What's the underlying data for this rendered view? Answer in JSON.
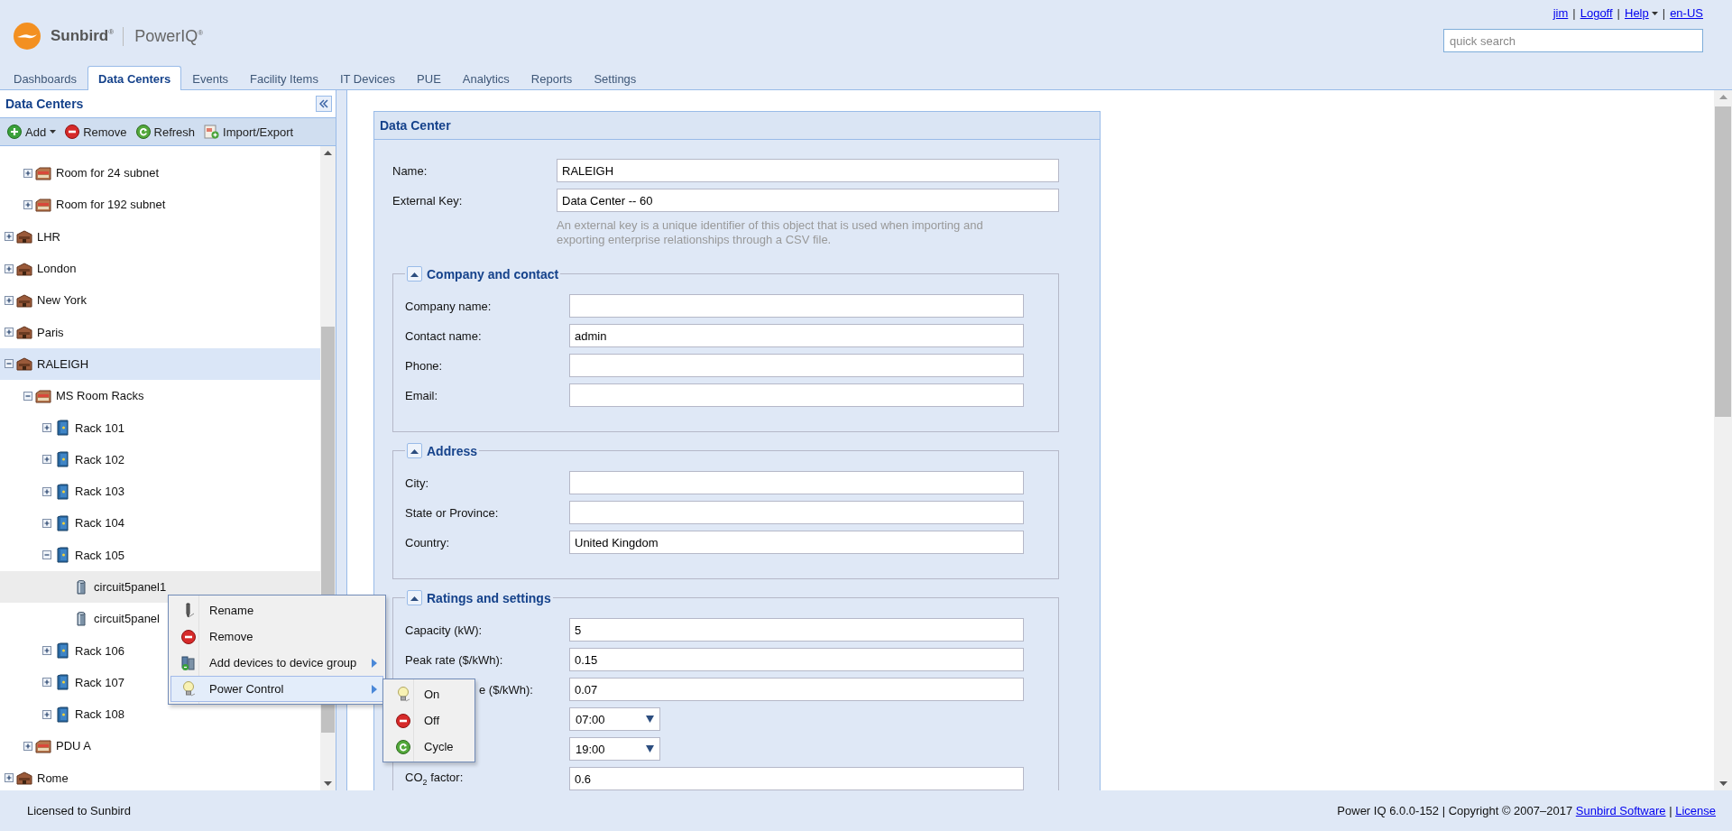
{
  "header": {
    "logo": {
      "brand": "Sunbird$^{®}$",
      "product": "PowerIQ$^{®}$"
    },
    "user_links": [
      {
        "label": "jim",
        "dropdown": false
      },
      {
        "label": "Logoff",
        "dropdown": false
      },
      {
        "label": "Help",
        "dropdown": true
      },
      {
        "label": "en-US",
        "dropdown": false
      }
    ],
    "separator": "|",
    "search": {
      "placeholder": "quick search"
    }
  },
  "tabs": [
    {
      "label": "Dashboards",
      "selected": false
    },
    {
      "label": "Data Centers",
      "selected": true
    },
    {
      "label": "Events",
      "selected": false
    },
    {
      "label": "Facility Items",
      "selected": false
    },
    {
      "label": "IT Devices",
      "selected": false
    },
    {
      "label": "PUE",
      "selected": false
    },
    {
      "label": "Analytics",
      "selected": false
    },
    {
      "label": "Reports",
      "selected": false
    },
    {
      "label": "Settings",
      "selected": false
    }
  ],
  "sidebar": {
    "title": "Data Centers",
    "toolbar": [
      {
        "label": "Add",
        "kind": "add",
        "dropdown": true
      },
      {
        "label": "Remove",
        "kind": "remove",
        "dropdown": false
      },
      {
        "label": "Refresh",
        "kind": "refresh",
        "dropdown": false
      },
      {
        "label": "Import/Export",
        "kind": "import",
        "dropdown": false
      }
    ]
  },
  "tree": {
    "items": [
      {
        "children": [
          {
            "label": "Room for 24 subnet",
            "kind": "room",
            "expanded": false,
            "selected": false,
            "hovered": false
          },
          {
            "label": "Room for 192 subnet",
            "kind": "room",
            "expanded": false,
            "selected": false,
            "hovered": false
          }
        ]
      },
      {
        "label": "LHR",
        "kind": "building",
        "expanded": false,
        "selected": false,
        "hovered": false
      },
      {
        "label": "London",
        "kind": "building",
        "expanded": false,
        "selected": false,
        "hovered": false
      },
      {
        "label": "New York",
        "kind": "building",
        "expanded": false,
        "selected": false,
        "hovered": false
      },
      {
        "label": "Paris",
        "kind": "building",
        "expanded": false,
        "selected": false,
        "hovered": false
      },
      {
        "label": "RALEIGH",
        "kind": "building",
        "expanded": true,
        "selected": true,
        "hovered": false,
        "children": [
          {
            "label": "MS Room Racks",
            "kind": "room",
            "expanded": true,
            "selected": false,
            "hovered": false,
            "children": [
              {
                "label": "Rack 101",
                "kind": "rack",
                "expanded": false,
                "selected": false,
                "hovered": false
              },
              {
                "label": "Rack 102",
                "kind": "rack",
                "expanded": false,
                "selected": false,
                "hovered": false
              },
              {
                "label": "Rack 103",
                "kind": "rack",
                "expanded": false,
                "selected": false,
                "hovered": false
              },
              {
                "label": "Rack 104",
                "kind": "rack",
                "expanded": false,
                "selected": false,
                "hovered": false
              },
              {
                "label": "Rack 105",
                "kind": "rack",
                "expanded": true,
                "selected": false,
                "hovered": false,
                "children": [
                  {
                    "label": "circuit5panel1",
                    "kind": "device",
                    "selected": false,
                    "hovered": true
                  },
                  {
                    "label": "circuit5panel",
                    "kind": "device",
                    "selected": false,
                    "hovered": false
                  }
                ]
              },
              {
                "label": "Rack 106",
                "kind": "rack",
                "expanded": false,
                "selected": false,
                "hovered": false
              },
              {
                "label": "Rack 107",
                "kind": "rack",
                "expanded": false,
                "selected": false,
                "hovered": false
              },
              {
                "label": "Rack 108",
                "kind": "rack",
                "expanded": false,
                "selected": false,
                "hovered": false
              }
            ]
          },
          {
            "label": "PDU A",
            "kind": "room",
            "expanded": false,
            "selected": false,
            "hovered": false
          }
        ]
      },
      {
        "label": "Rome",
        "kind": "building",
        "expanded": false,
        "selected": false,
        "hovered": false
      }
    ]
  },
  "context_menu": {
    "items": [
      {
        "label": "Rename",
        "kind": "rename",
        "submenu": false,
        "selected": false
      },
      {
        "label": "Remove",
        "kind": "remove",
        "submenu": false,
        "selected": false
      },
      {
        "label": "Add devices to device group",
        "kind": "group",
        "submenu": true,
        "selected": false
      },
      {
        "label": "Power Control",
        "kind": "power",
        "submenu": true,
        "selected": true
      }
    ],
    "submenu": {
      "items": [
        {
          "label": "On",
          "kind": "on",
          "selected": false
        },
        {
          "label": "Off",
          "kind": "off",
          "selected": false
        },
        {
          "label": "Cycle",
          "kind": "cycle",
          "selected": false
        }
      ]
    }
  },
  "form": {
    "title": "Data Center",
    "fields": [
      {
        "label": "Name:",
        "value": "RALEIGH"
      },
      {
        "label": "External Key:",
        "value": "Data Center -- 60"
      }
    ],
    "hint": "An external key is a unique identifier of this object that is used when importing and exporting enterprise relationships through a CSV file.",
    "sections": [
      {
        "title": "Company and contact",
        "expanded": true,
        "fields": [
          {
            "label": "Company name:"
          },
          {
            "label": "Contact name:",
            "value": "admin"
          },
          {
            "label": "Phone:"
          },
          {
            "label": "Email:"
          }
        ]
      },
      {
        "title": "Address",
        "expanded": true,
        "fields": [
          {
            "label": "City:"
          },
          {
            "label": "State or Province:"
          },
          {
            "label": "Country:",
            "value": "United Kingdom"
          }
        ]
      },
      {
        "title": "Ratings and settings",
        "expanded": true,
        "fields": [
          {
            "kind": "text",
            "label": "Capacity (kW):",
            "value": "5"
          },
          {
            "kind": "text",
            "label": "Peak rate ($/kWh):",
            "value": "0.15"
          },
          {
            "kind": "text",
            "label": "e ($/kWh):",
            "obscured": true,
            "value": "0.07"
          },
          {
            "kind": "select",
            "value": "07:00"
          },
          {
            "kind": "select",
            "value": "19:00"
          },
          {
            "kind": "text",
            "label": "CO$_{2}$ factor:",
            "value": "0.6"
          }
        ]
      }
    ]
  },
  "footer": {
    "license": "Licensed to Sunbird",
    "copyright": {
      "text": "Power IQ 6.0.0-152 | Copyright © 2007–2017",
      "links": [
        "Sunbird Software",
        "License"
      ],
      "separator": "|"
    }
  }
}
